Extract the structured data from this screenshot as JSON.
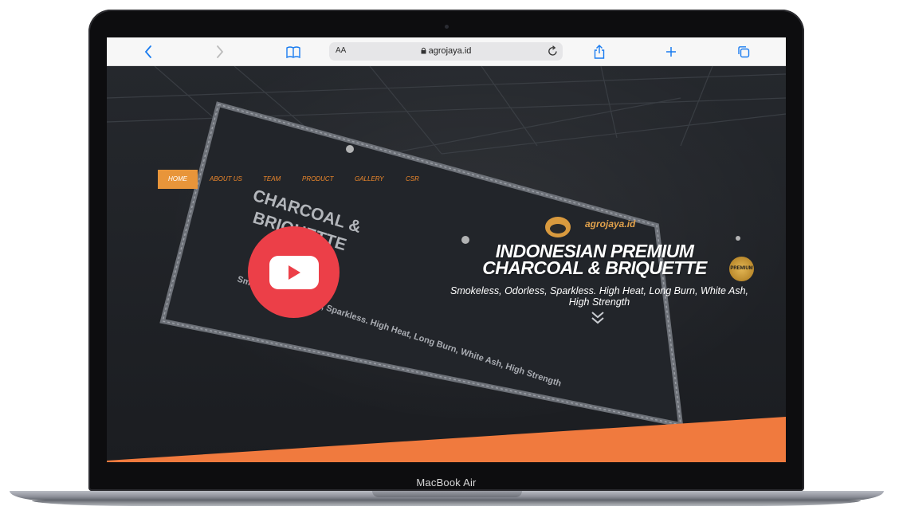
{
  "device": {
    "label": "MacBook Air"
  },
  "browser": {
    "address_bar": {
      "text_size_label": "AA",
      "url": "agrojaya.id"
    },
    "icons": [
      "back-icon",
      "forward-icon",
      "bookmarks-icon",
      "lock-icon",
      "reload-icon",
      "share-icon",
      "new-tab-icon",
      "tabs-icon"
    ]
  },
  "site": {
    "nav": [
      {
        "label": "HOME",
        "active": true
      },
      {
        "label": "ABOUT US",
        "active": false
      },
      {
        "label": "TEAM",
        "active": false
      },
      {
        "label": "PRODUCT",
        "active": false
      },
      {
        "label": "GALLERY",
        "active": false
      },
      {
        "label": "CSR",
        "active": false
      }
    ],
    "brand_name": "agrojaya.id",
    "badge_text": "PREMIUM",
    "hero": {
      "title_line1": "INDONESIAN PREMIUM",
      "title_line2": "CHARCOAL & BRIQUETTE",
      "subtitle": "Smokeless, Odorless, Sparkless. High Heat, Long Burn, White Ash, High Strength"
    },
    "banner_photo": {
      "line1": "CHARCOAL &",
      "line2": "BRIQUETTE",
      "line3": "Smokeless, Odorless, Sparkless. High Heat, Long Burn, White Ash, High Strength"
    },
    "colors": {
      "accent_orange": "#f07a3e",
      "nav_orange": "#f0892b",
      "play_red": "#ec3f48"
    }
  }
}
